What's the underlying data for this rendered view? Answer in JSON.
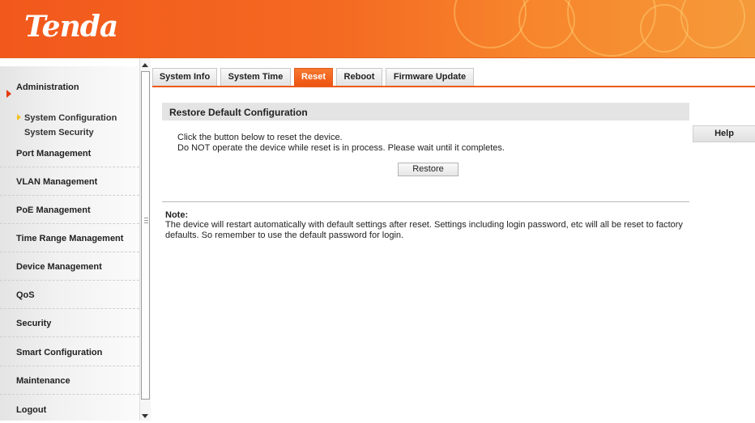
{
  "brand": {
    "logo_text": "Tenda",
    "accent": "#ee5412"
  },
  "sidebar": {
    "items": [
      {
        "label": "Administration",
        "active": true
      },
      {
        "label": "System Configuration",
        "sub": true,
        "active": true
      },
      {
        "label": "System Security",
        "sub": true
      },
      {
        "label": "Port Management"
      },
      {
        "label": "VLAN Management"
      },
      {
        "label": "PoE Management"
      },
      {
        "label": "Time Range Management"
      },
      {
        "label": "Device Management"
      },
      {
        "label": "QoS"
      },
      {
        "label": "Security"
      },
      {
        "label": "Smart Configuration"
      },
      {
        "label": "Maintenance"
      },
      {
        "label": "Logout"
      }
    ]
  },
  "tabs": [
    {
      "label": "System Info"
    },
    {
      "label": "System Time"
    },
    {
      "label": "Reset",
      "active": true
    },
    {
      "label": "Reboot"
    },
    {
      "label": "Firmware Update"
    }
  ],
  "section": {
    "title": "Restore Default Configuration",
    "line1": "Click the button below to reset the device.",
    "line2": "Do NOT operate the device while reset is in process. Please wait until it completes.",
    "restore_label": "Restore"
  },
  "help_label": "Help",
  "note": {
    "label": "Note:",
    "line1": "The device will restart automatically with default settings after reset. Settings including login password, etc will all be reset to factory",
    "line2": "defaults. So remember to use the default password for login."
  }
}
